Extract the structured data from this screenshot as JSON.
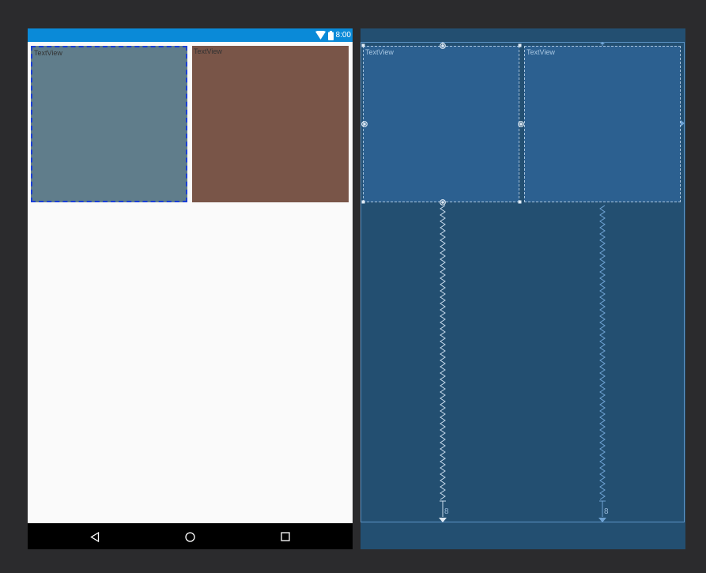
{
  "design": {
    "status_bar": {
      "time": "8:00",
      "wifi_icon": "wifi-icon",
      "battery_icon": "battery-icon",
      "color": "#0a8ad8"
    },
    "text_views": [
      {
        "label": "TextView",
        "color": "#607d8b",
        "selected": true
      },
      {
        "label": "TextView",
        "color": "#795548",
        "selected": false
      }
    ],
    "nav_bar": {
      "back_icon": "back-triangle-icon",
      "home_icon": "home-circle-icon",
      "recents_icon": "recents-square-icon"
    }
  },
  "blueprint": {
    "text_views": [
      {
        "label": "TextView"
      },
      {
        "label": "TextView"
      }
    ],
    "margins": [
      "8",
      "8"
    ],
    "colors": {
      "background": "#234f71",
      "widget": "#2c6090",
      "line": "#aac6e0"
    }
  }
}
